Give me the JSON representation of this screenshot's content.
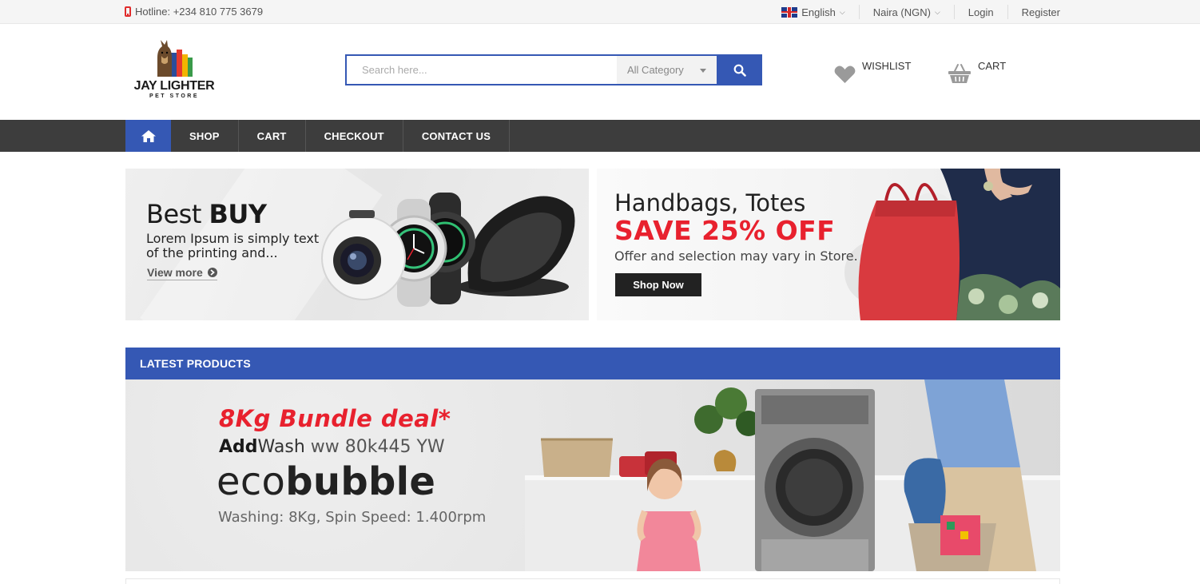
{
  "topbar": {
    "hotline": "Hotline: +234 810 775 3679",
    "language": "English",
    "currency": "Naira (NGN)",
    "login": "Login",
    "register": "Register"
  },
  "header": {
    "logo_title": "JAY LIGHTER",
    "logo_subtitle": "PET STORE",
    "search_placeholder": "Search here...",
    "search_category": "All Category",
    "wishlist_label": "WISHLIST",
    "cart_label": "CART"
  },
  "nav": {
    "items": [
      "SHOP",
      "CART",
      "CHECKOUT",
      "CONTACT US"
    ]
  },
  "banner_left": {
    "title_light": "Best ",
    "title_bold": "BUY",
    "text": "Lorem Ipsum is simply text of the printing and...",
    "link": "View more"
  },
  "banner_right": {
    "title": "Handbags, Totes",
    "save": "SAVE 25% OFF",
    "text": "Offer and selection may vary in Store.",
    "button": "Shop Now"
  },
  "latest": {
    "heading": "LATEST PRODUCTS"
  },
  "promo": {
    "deal": "8Kg Bundle deal*",
    "model_bold": "Add",
    "model_wash": "Wash",
    "model_rest": " ww 80k445 YW",
    "eco_light": "eco",
    "eco_bold": "bubble",
    "spec": "Washing: 8Kg, Spin Speed: 1.400rpm"
  },
  "colors": {
    "accent_blue": "#3558b4",
    "nav_dark": "#3d3d3d",
    "sale_red": "#e8212e",
    "hotline_red": "#e02b2b"
  },
  "icons": [
    "phone-icon",
    "flag-uk-icon",
    "chevron-down-icon",
    "search-icon",
    "heart-icon",
    "basket-icon",
    "home-icon",
    "arrow-circle-right-icon"
  ]
}
